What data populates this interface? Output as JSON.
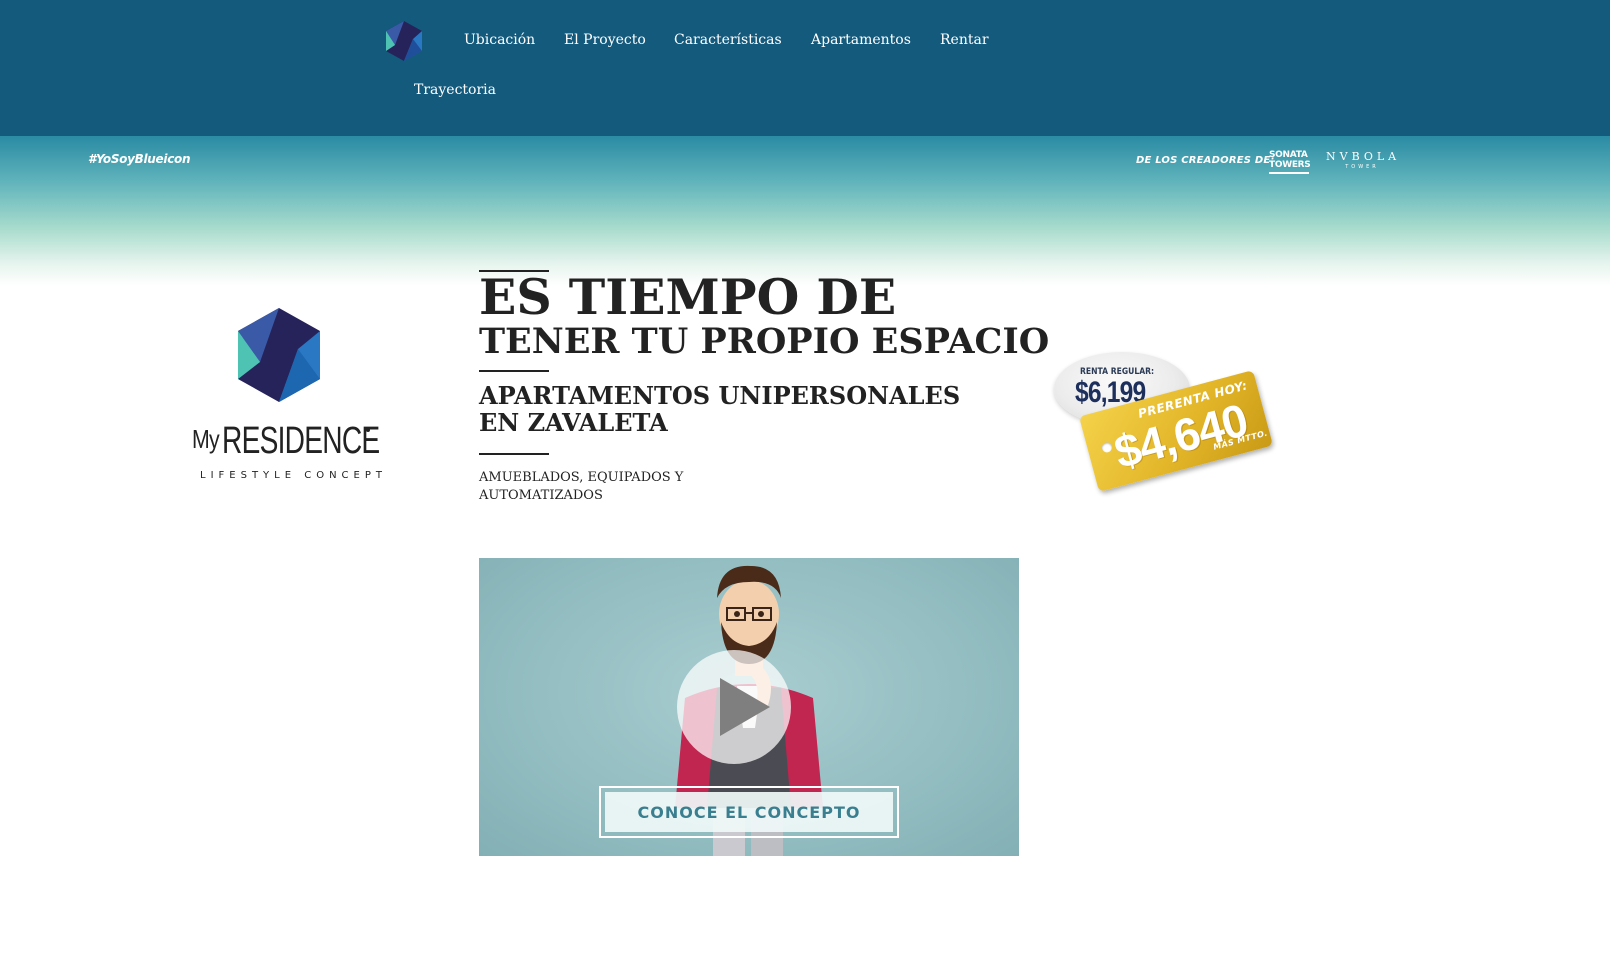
{
  "nav": {
    "items": [
      {
        "label": "Ubicación"
      },
      {
        "label": "El Proyecto"
      },
      {
        "label": "Características"
      },
      {
        "label": "Apartamentos"
      },
      {
        "label": "Rentar"
      },
      {
        "label": "Trayectoria"
      }
    ]
  },
  "band": {
    "hashtag": "#YoSoyBlueicon",
    "creators_label": "DE LOS CREADORES DE:",
    "partner_sonata": {
      "line1": "SONATA",
      "line2": "TOWERS"
    },
    "partner_nvbola": {
      "line1": "NVBOLA",
      "line2": "TOWER"
    }
  },
  "brand": {
    "my": "My",
    "name": "RESIDENCE",
    "tagline": "LIFESTYLE CONCEPT"
  },
  "hero": {
    "title_line1": "ES TIEMPO DE",
    "title_line2": "TENER TU PROPIO ESPACIO",
    "subtitle_line1": "APARTAMENTOS UNIPERSONALES",
    "subtitle_line2": "EN ZAVALETA",
    "features_line1": "AMUEBLADOS, EQUIPADOS Y",
    "features_line2": "AUTOMATIZADOS"
  },
  "price": {
    "regular_label": "RENTA REGULAR:",
    "regular_value": "$6,199",
    "prerenta_label": "PRERENTA HOY:",
    "prerenta_value": "$4,640",
    "prerenta_note": "MÁS MTTO."
  },
  "video": {
    "cta_label": "CONOCE EL CONCEPTO"
  },
  "colors": {
    "nav_bg": "#135a7d",
    "accent_gold": "#e3b629",
    "hex_dark": "#26235a",
    "hex_teal": "#4fc3b3",
    "hex_blue": "#2a78c4"
  }
}
